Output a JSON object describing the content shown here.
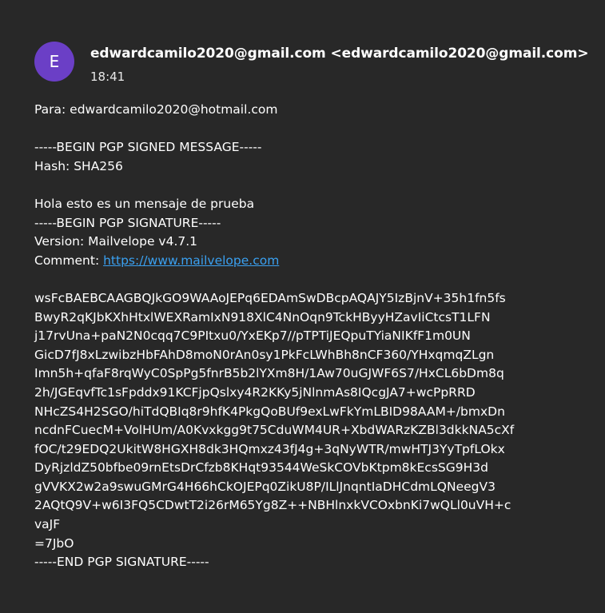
{
  "header": {
    "avatar_letter": "E",
    "sender": "edwardcamilo2020@gmail.com <edwardcamilo2020@gmail.com>",
    "time": "18:41"
  },
  "colors": {
    "background": "#282828",
    "avatar": "#6b3fc6",
    "link": "#3aa0f0"
  },
  "message": {
    "to_line": "Para: edwardcamilo2020@hotmail.com",
    "begin_signed": "-----BEGIN PGP SIGNED MESSAGE-----",
    "hash": "Hash: SHA256",
    "text": "Hola esto es un mensaje de prueba",
    "begin_signature": "-----BEGIN PGP SIGNATURE-----",
    "version": "Version: Mailvelope v4.7.1",
    "comment_label": "Comment: ",
    "comment_link": "https://www.mailvelope.com",
    "signature_lines": [
      "wsFcBAEBCAAGBQJkGO9WAAoJEPq6EDAmSwDBcpAQAJY5IzBjnV+35h1fn5fs",
      "BwyR2qKJbKXhHtxlWEXRamIxN918XlC4NnOqn9TckHByyHZavIiCtcsT1LFN",
      "j17rvUna+paN2N0cqq7C9PItxu0/YxEKp7//pTPTiJEQpuTYiaNIKfF1m0UN",
      "GicD7fJ8xLzwibzHbFAhD8moN0rAn0sy1PkFcLWhBh8nCF360/YHxqmqZLgn",
      "Imn5h+qfaF8rqWyC0SpPg5fnrB5b2lYXm8H/1Aw70uGJWF6S7/HxCL6bDm8q",
      "2h/JGEqvfTc1sFpddx91KCFjpQslxy4R2KKy5jNlnmAs8IQcgJA7+wcPpRRD",
      "NHcZS4H2SGO/hiTdQBIq8r9hfK4PkgQoBUf9exLwFkYmLBID98AAM+/bmxDn",
      "ncdnFCuecM+VolHUm/A0Kvxkgg9t75CduWM4UR+XbdWARzKZBl3dkkNA5cXf",
      "fOC/t29EDQ2UkitW8HGXH8dk3HQmxz43fJ4g+3qNyWTR/mwHTJ3YyTpfLOkx",
      "DyRjzldZ50bfbe09rnEtsDrCfzb8KHqt93544WeSkCOVbKtpm8kEcsSG9H3d",
      "gVVKX2w2a9swuGMrG4H66hCkOJEPq0ZikU8P/ILlJnqntIaDHCdmLQNeegV3",
      "2AQtQ9V+w6I3FQ5CDwtT2i26rM65Yg8Z++NBHlnxkVCOxbnKi7wQLl0uVH+c",
      "vaJF",
      "=7JbO"
    ],
    "end_signature": "-----END PGP SIGNATURE-----"
  }
}
